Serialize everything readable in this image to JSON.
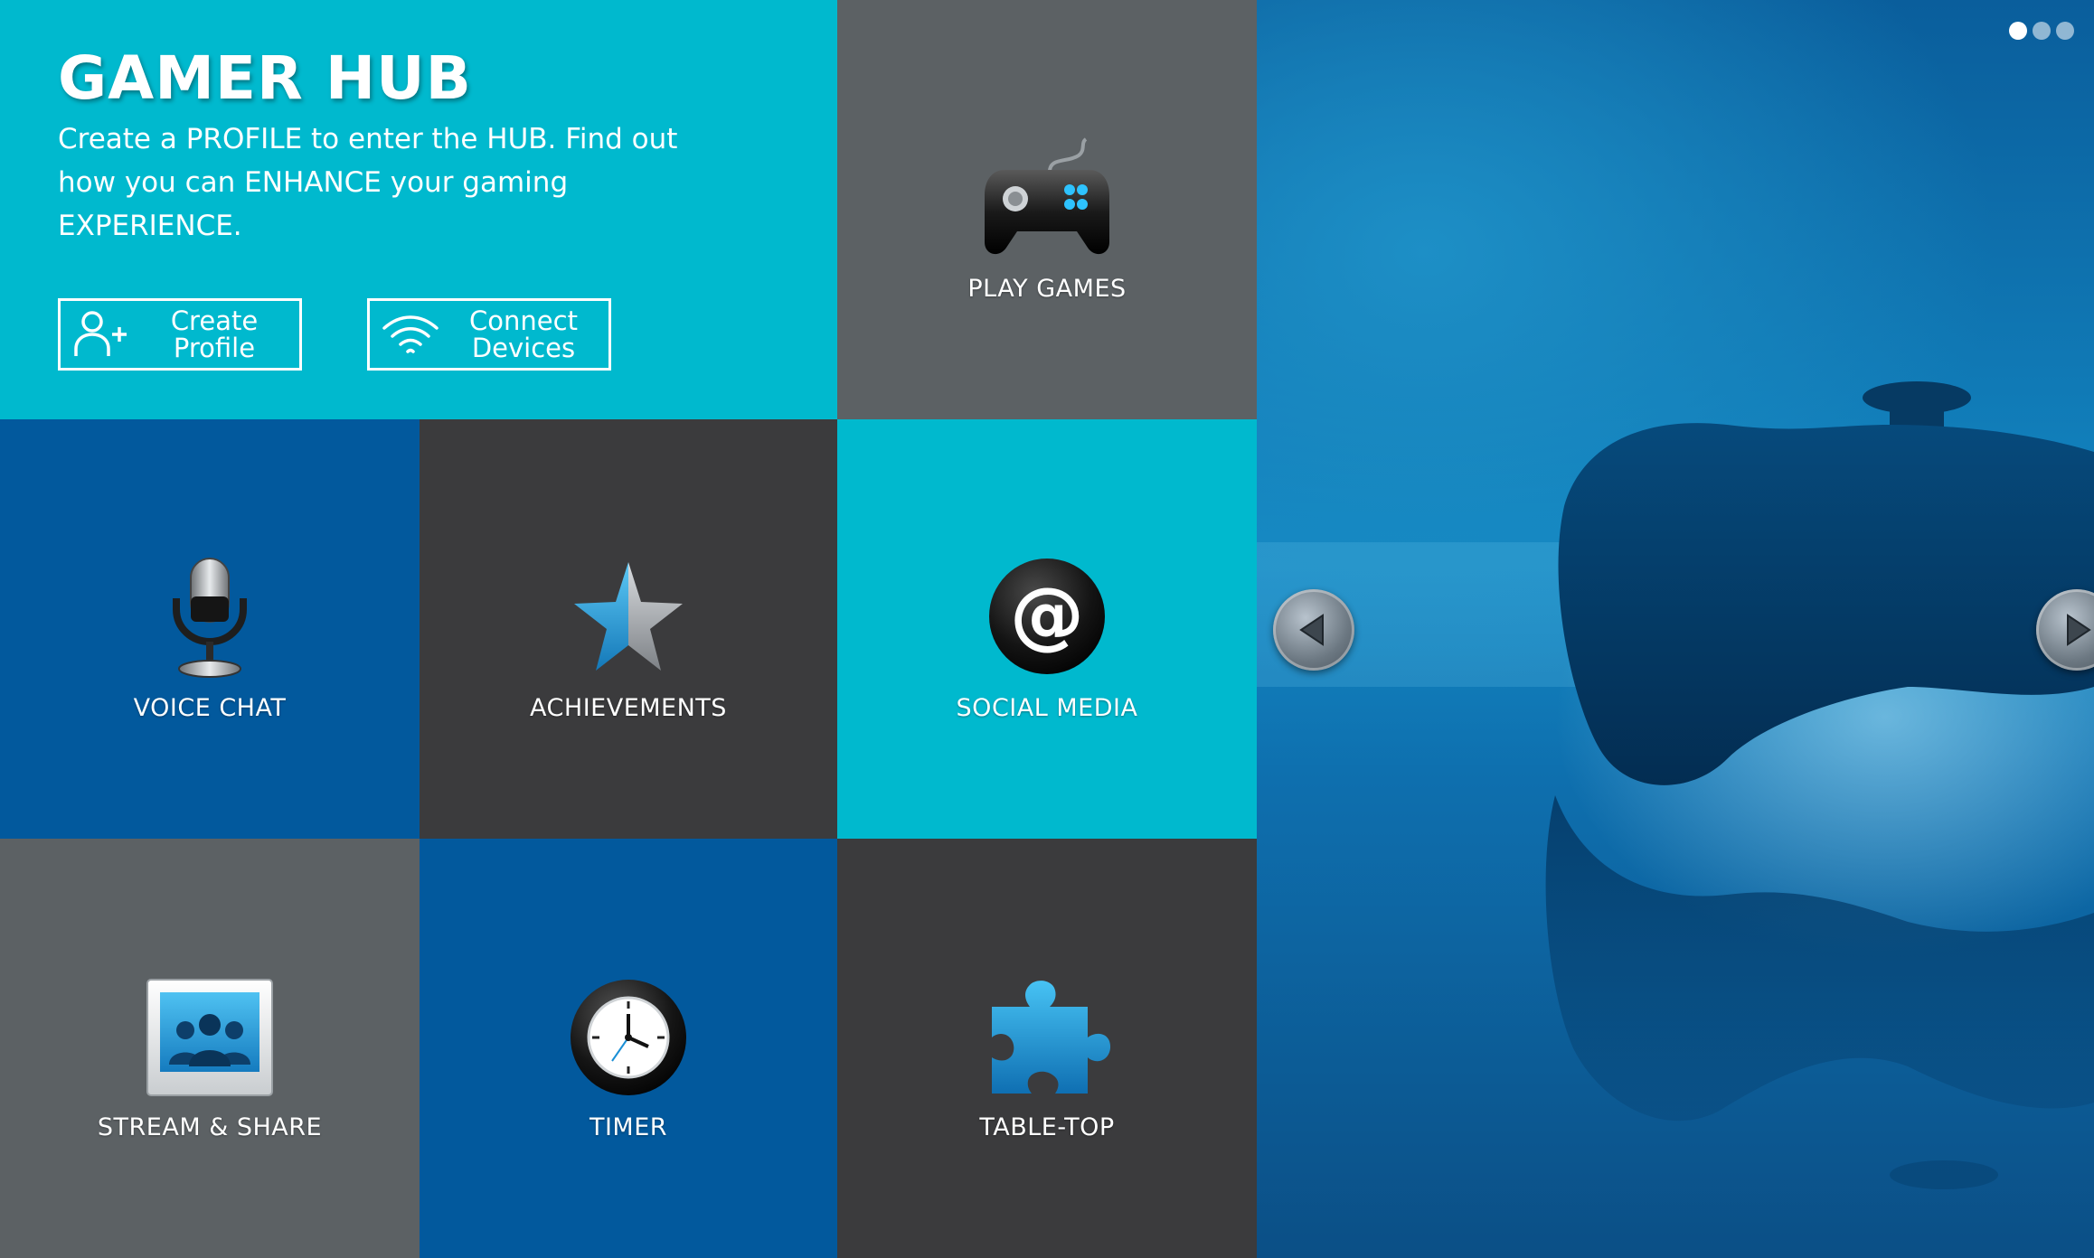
{
  "hero": {
    "title": "GAMER HUB",
    "description": "Create a PROFILE to enter the HUB. Find out how you can ENHANCE your gaming EXPERIENCE.",
    "create_profile": {
      "line1": "Create",
      "line2": "Profile"
    },
    "connect_devices": {
      "line1": "Connect",
      "line2": "Devices"
    }
  },
  "tiles": {
    "play_games": "PLAY GAMES",
    "voice_chat": "VOICE CHAT",
    "achievements": "ACHIEVEMENTS",
    "social_media": "SOCIAL MEDIA",
    "stream_share": "STREAM & SHARE",
    "timer": "TIMER",
    "table_top": "TABLE-TOP"
  },
  "icons": {
    "play_games": "gamepad-icon",
    "voice_chat": "microphone-icon",
    "achievements": "star-icon",
    "social_media": "at-sign-icon",
    "stream_share": "photo-people-icon",
    "timer": "clock-icon",
    "table_top": "puzzle-piece-icon",
    "create_profile": "add-user-icon",
    "connect_devices": "wifi-icon"
  },
  "slider": {
    "slide_count": 3,
    "active_slide": 1
  },
  "colors": {
    "cyan": "#00b9ce",
    "blue": "#02599d",
    "dark_gray": "#3b3b3d",
    "gray": "#5c6164",
    "text": "#ffffff"
  }
}
